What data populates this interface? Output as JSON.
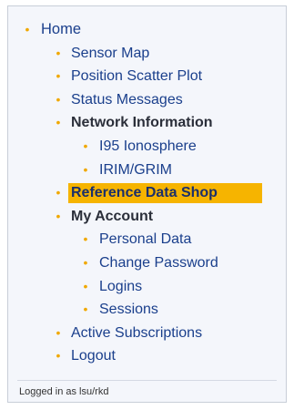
{
  "nav": {
    "items": [
      {
        "label": "Home"
      },
      {
        "label": "Sensor Map"
      },
      {
        "label": "Position Scatter Plot"
      },
      {
        "label": "Status Messages"
      },
      {
        "label": "Network Information"
      },
      {
        "label": "I95 Ionosphere"
      },
      {
        "label": "IRIM/GRIM"
      },
      {
        "label": "Reference Data Shop"
      },
      {
        "label": "My Account"
      },
      {
        "label": "Personal Data"
      },
      {
        "label": "Change Password"
      },
      {
        "label": "Logins"
      },
      {
        "label": "Sessions"
      },
      {
        "label": "Active Subscriptions"
      },
      {
        "label": "Logout"
      }
    ]
  },
  "footer": {
    "status": "Logged in as lsu/rkd"
  },
  "colors": {
    "bullet": "#f0a800",
    "active_highlight": "#f6b400",
    "link": "#1a3f8c"
  }
}
